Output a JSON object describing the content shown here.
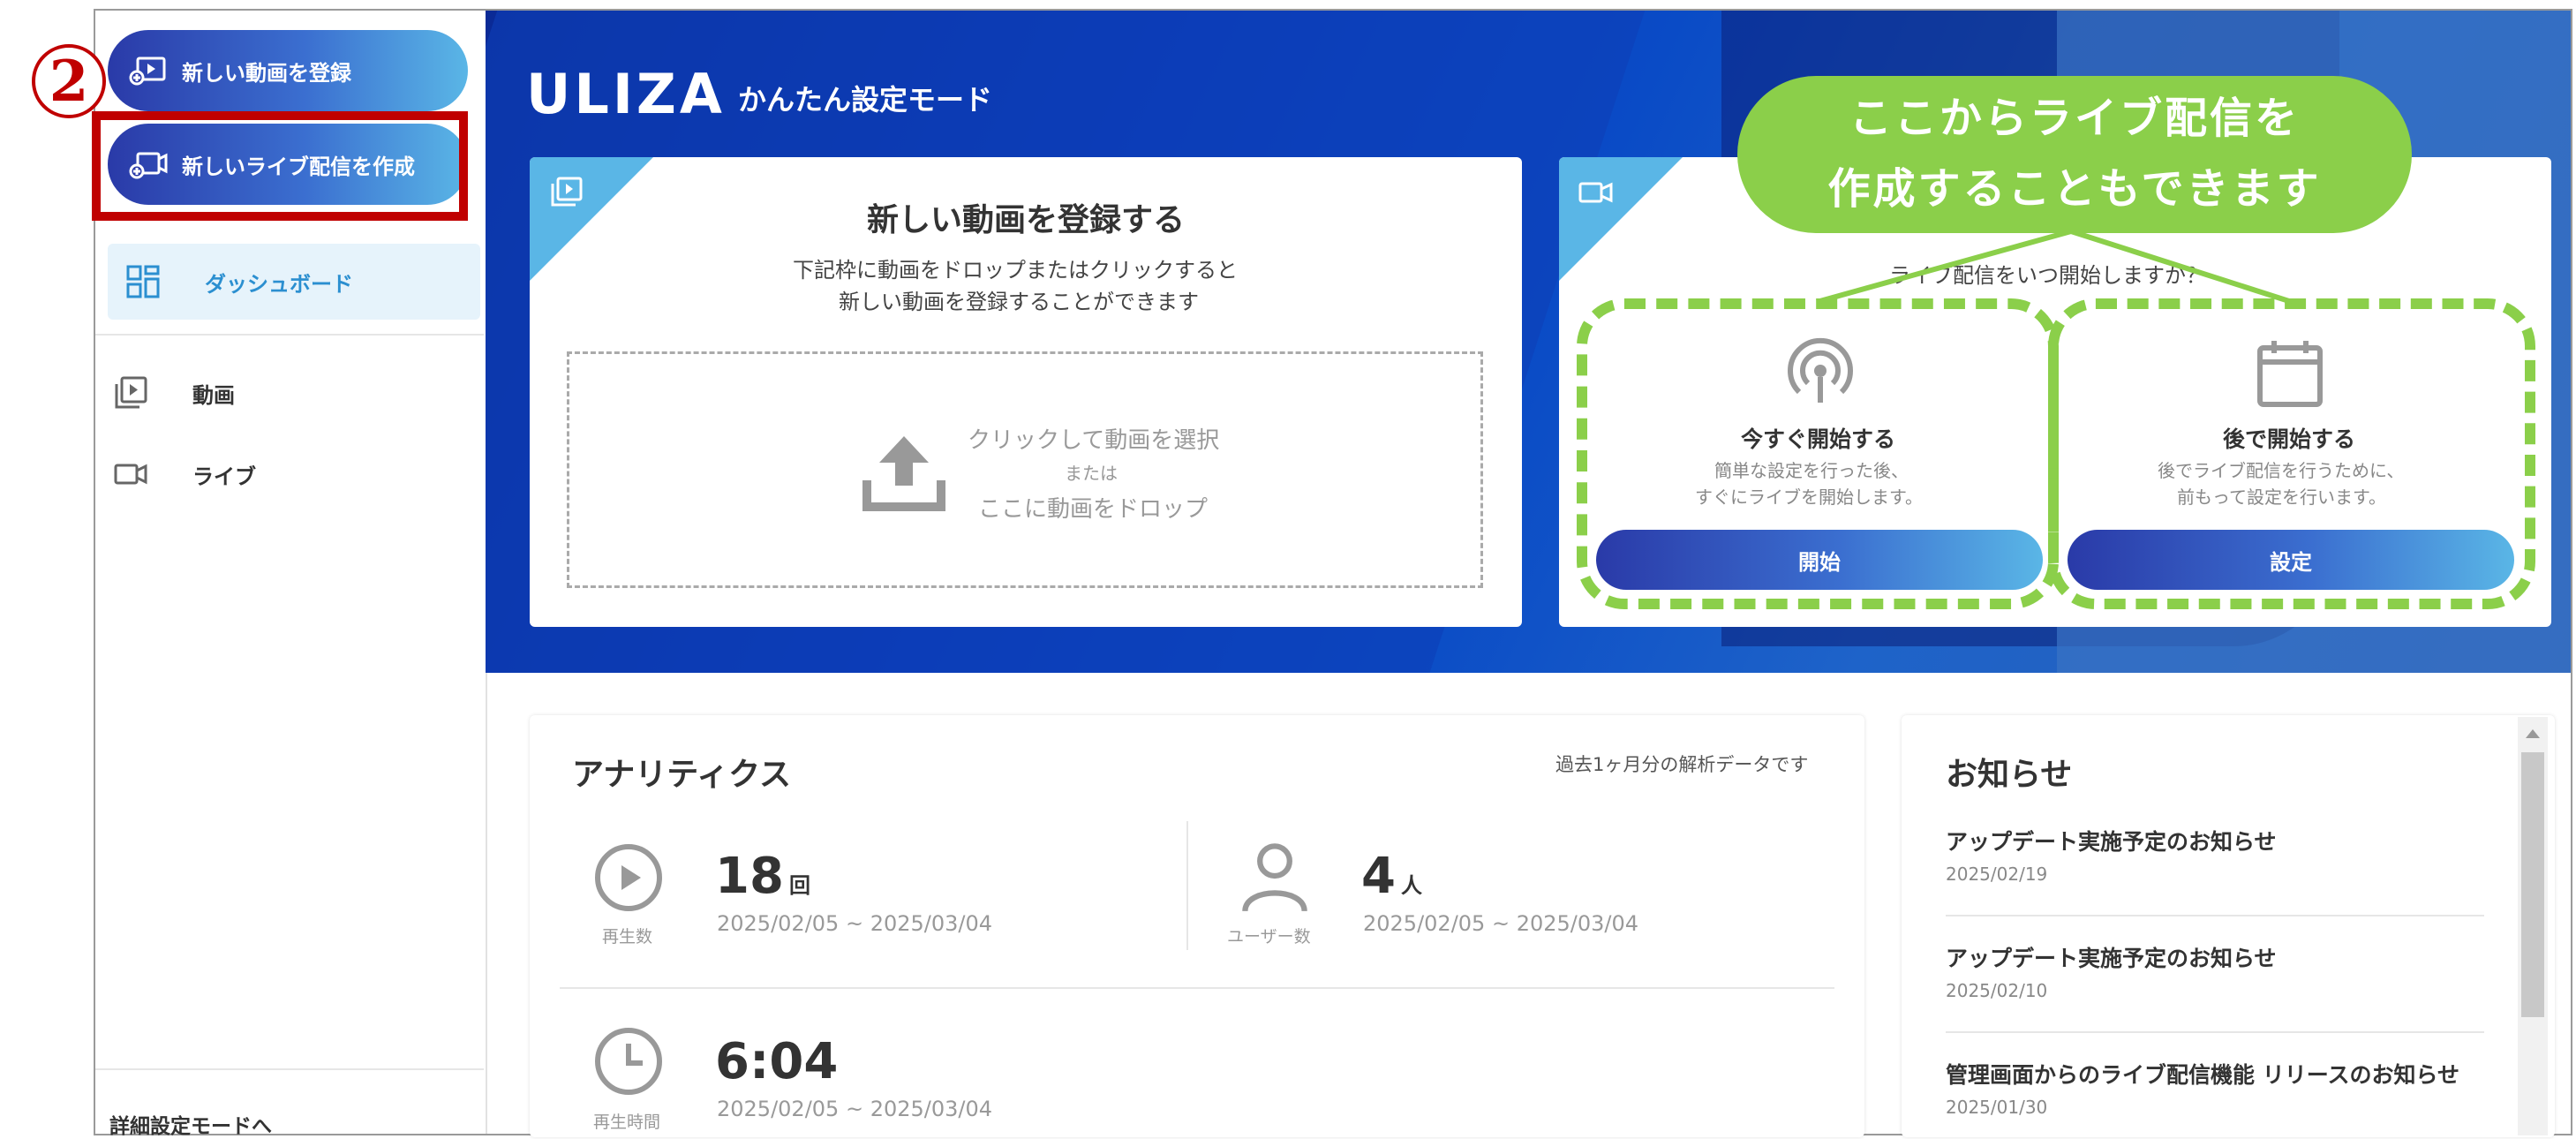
{
  "annotation": {
    "step_number": "2",
    "callout_line1": "ここからライブ配信を",
    "callout_line2": "作成することもできます",
    "callout_color": "#8bcf4a",
    "highlight_color": "#c00000"
  },
  "sidebar": {
    "new_video_button": "新しい動画を登録",
    "new_live_button": "新しいライブ配信を作成",
    "items": [
      {
        "label": "ダッシュボード",
        "icon": "dashboard-icon",
        "active": true
      },
      {
        "label": "動画",
        "icon": "video-library-icon",
        "active": false
      },
      {
        "label": "ライブ",
        "icon": "camera-icon",
        "active": false
      }
    ],
    "footer_link": "詳細設定モードへ"
  },
  "header": {
    "brand": "ULIZA",
    "mode_label": "かんたん設定モード"
  },
  "upload_card": {
    "title": "新しい動画を登録する",
    "desc_line1": "下記枠に動画をドロップまたはクリックすると",
    "desc_line2": "新しい動画を登録することができます",
    "drop_line1": "クリックして動画を選択",
    "drop_line2": "または",
    "drop_line3": "ここに動画をドロップ"
  },
  "live_card": {
    "question": "ライブ配信をいつ開始しますか？",
    "now_title": "今すぐ開始する",
    "now_desc1": "簡単な設定を行った後、",
    "now_desc2": "すぐにライブを開始します。",
    "now_button": "開始",
    "later_title": "後で開始する",
    "later_desc1": "後でライブ配信を行うために、",
    "later_desc2": "前もって設定を行います。",
    "later_button": "設定"
  },
  "analytics": {
    "title": "アナリティクス",
    "note": "過去1ヶ月分の解析データです",
    "plays": {
      "value": "18",
      "unit": "回",
      "range": "2025/02/05 ~ 2025/03/04",
      "caption": "再生数"
    },
    "users": {
      "value": "4",
      "unit": "人",
      "range": "2025/02/05 ~ 2025/03/04",
      "caption": "ユーザー数"
    },
    "time": {
      "value": "6:04",
      "range": "2025/02/05 ~ 2025/03/04",
      "caption": "再生時間"
    }
  },
  "news": {
    "title": "お知らせ",
    "items": [
      {
        "title": "アップデート実施予定のお知らせ",
        "date": "2025/02/19"
      },
      {
        "title": "アップデート実施予定のお知らせ",
        "date": "2025/02/10"
      },
      {
        "title": "管理画面からのライブ配信機能 リリースのお知らせ",
        "date": "2025/01/30"
      }
    ]
  }
}
